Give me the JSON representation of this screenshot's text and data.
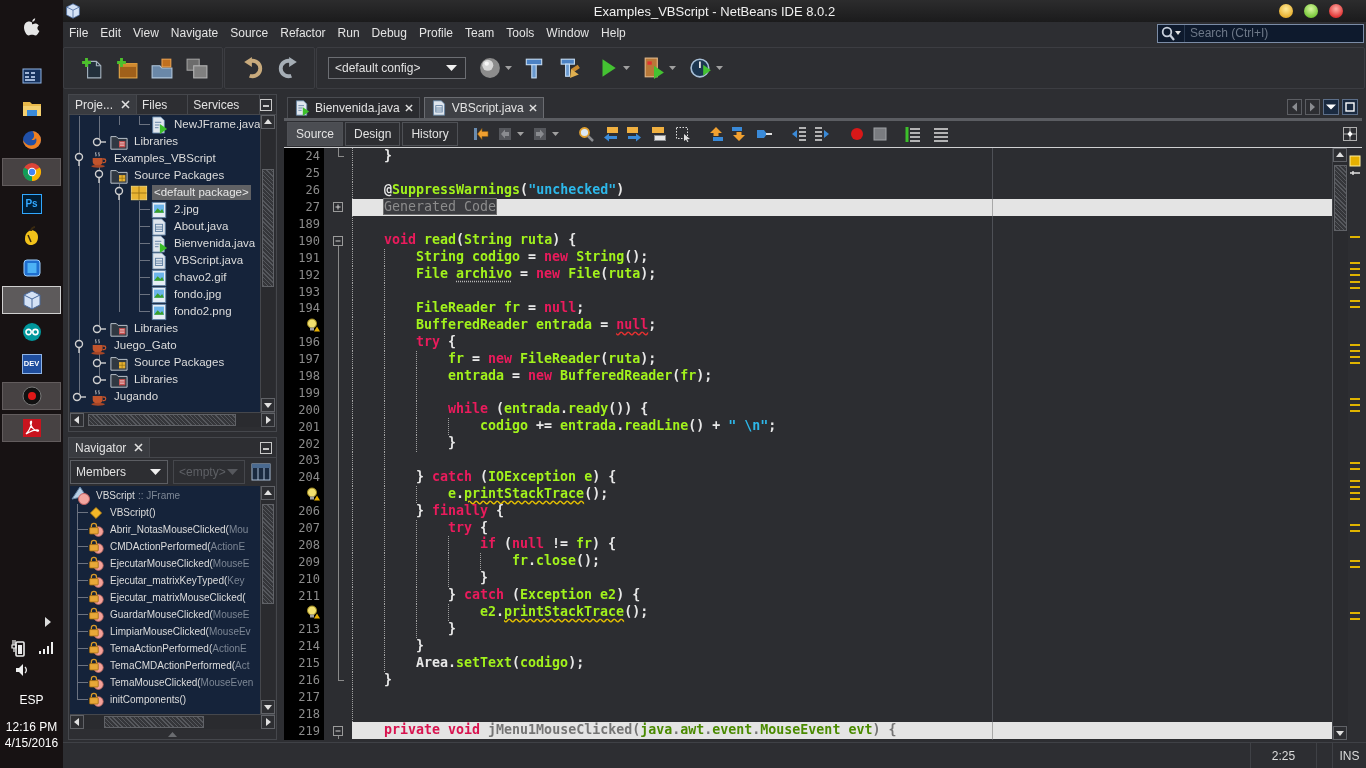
{
  "taskbar": {
    "apps": [
      {
        "kind": "apple",
        "running": false,
        "selected": false
      },
      {
        "kind": "window-grid",
        "running": false,
        "selected": false
      },
      {
        "kind": "explorer",
        "running": false,
        "selected": false
      },
      {
        "kind": "firefox",
        "running": false,
        "selected": false
      },
      {
        "kind": "chrome",
        "running": true,
        "selected": false
      },
      {
        "kind": "photoshop",
        "label": "Ps",
        "running": false,
        "selected": false
      },
      {
        "kind": "fruit",
        "running": false,
        "selected": false
      },
      {
        "kind": "tablet",
        "running": false,
        "selected": false
      },
      {
        "kind": "cube",
        "running": true,
        "selected": true
      },
      {
        "kind": "infinity",
        "running": false,
        "selected": false
      },
      {
        "kind": "devcpp",
        "label": "DEV",
        "running": false,
        "selected": false
      },
      {
        "kind": "record",
        "running": true,
        "selected": false
      },
      {
        "kind": "pdf",
        "running": true,
        "selected": false
      }
    ],
    "language": "ESP",
    "time": "12:16 PM",
    "date": "4/15/2016"
  },
  "window": {
    "title": "Examples_VBScript - NetBeans IDE 8.0.2"
  },
  "menu": [
    "File",
    "Edit",
    "View",
    "Navigate",
    "Source",
    "Refactor",
    "Run",
    "Debug",
    "Profile",
    "Team",
    "Tools",
    "Window",
    "Help"
  ],
  "search": {
    "placeholder": "Search (Ctrl+I)"
  },
  "toolbar": {
    "config": "<default config>"
  },
  "projects": {
    "tabs": [
      {
        "label": "Proje...",
        "selected": true,
        "closable": true
      },
      {
        "label": "Files",
        "selected": false,
        "closable": false
      },
      {
        "label": "Services",
        "selected": false,
        "closable": false
      }
    ],
    "tree": [
      {
        "children": [
          {
            "children": [
              {
                "children": [
                  {
                    "kind": "form",
                    "label": "NewJFrame.java",
                    "selected": false
                  }
                ]
              }
            ]
          },
          {
            "kind": "libraries",
            "label": "Libraries",
            "expanded": false,
            "selected": false
          }
        ]
      },
      {
        "kind": "project",
        "label": "Examples_VBScript",
        "expanded": true,
        "selected": false,
        "children": [
          {
            "kind": "source-packages",
            "label": "Source Packages",
            "expanded": true,
            "selected": false,
            "children": [
              {
                "kind": "package",
                "label": "<default package>",
                "expanded": true,
                "selected": true,
                "children": [
                  {
                    "kind": "image",
                    "label": "2.jpg",
                    "selected": false
                  },
                  {
                    "kind": "java",
                    "label": "About.java",
                    "selected": false
                  },
                  {
                    "kind": "form",
                    "label": "Bienvenida.java",
                    "selected": false
                  },
                  {
                    "kind": "java",
                    "label": "VBScript.java",
                    "selected": false
                  },
                  {
                    "kind": "image",
                    "label": "chavo2.gif",
                    "selected": false
                  },
                  {
                    "kind": "image",
                    "label": "fondo.jpg",
                    "selected": false
                  },
                  {
                    "kind": "image",
                    "label": "fondo2.png",
                    "selected": false
                  }
                ]
              }
            ]
          },
          {
            "kind": "libraries",
            "label": "Libraries",
            "expanded": false,
            "selected": false
          }
        ]
      },
      {
        "kind": "project",
        "label": "Juego_Gato",
        "expanded": true,
        "selected": false,
        "children": [
          {
            "kind": "source-packages",
            "label": "Source Packages",
            "expanded": false,
            "selected": false
          },
          {
            "kind": "libraries",
            "label": "Libraries",
            "expanded": false,
            "selected": false
          }
        ]
      },
      {
        "kind": "project",
        "label": "Jugando",
        "expanded": false,
        "selected": false
      }
    ]
  },
  "navigator": {
    "title": "Navigator",
    "view": "Members",
    "filter": {
      "text": "<empty>",
      "disabled": true
    },
    "members": [
      {
        "kind": "class",
        "label": "VBScript",
        "detail": ":: JFrame",
        "children": [
          {
            "kind": "constructor",
            "label": "VBScript()"
          },
          {
            "kind": "private-method",
            "label": "Abrir_NotasMouseClicked(",
            "detail": "Mou"
          },
          {
            "kind": "private-method",
            "label": "CMDActionPerformed(",
            "detail": "ActionE"
          },
          {
            "kind": "private-method",
            "label": "EjecutarMouseClicked(",
            "detail": "MouseE"
          },
          {
            "kind": "private-method",
            "label": "Ejecutar_matrixKeyTyped(",
            "detail": "Key"
          },
          {
            "kind": "private-method",
            "label": "Ejecutar_matrixMouseClicked("
          },
          {
            "kind": "private-method",
            "label": "GuardarMouseClicked(",
            "detail": "MouseE"
          },
          {
            "kind": "private-method",
            "label": "LimpiarMouseClicked(",
            "detail": "MouseEv"
          },
          {
            "kind": "private-method",
            "label": "TemaActionPerformed(",
            "detail": "ActionE"
          },
          {
            "kind": "private-method",
            "label": "TemaCMDActionPerformed(",
            "detail": "Act"
          },
          {
            "kind": "private-method",
            "label": "TemaMouseClicked(",
            "detail": "MouseEven"
          },
          {
            "kind": "private-method",
            "label": "initComponents()"
          }
        ]
      }
    ]
  },
  "editor": {
    "tabs": [
      {
        "kind": "form",
        "label": "Bienvenida.java",
        "selected": false
      },
      {
        "kind": "java",
        "label": "VBScript.java",
        "selected": true
      }
    ],
    "views": [
      {
        "label": "Source",
        "selected": true
      },
      {
        "label": "Design",
        "selected": false
      },
      {
        "label": "History",
        "selected": false
      }
    ],
    "lines": [
      {
        "kind": "fold-end",
        "number": "24",
        "hint": false,
        "highlight": false,
        "tokens": [
          {
            "kind": "plain",
            "text": "    }"
          }
        ]
      },
      {
        "kind": "plain",
        "number": "25",
        "hint": false,
        "highlight": false
      },
      {
        "kind": "plain",
        "number": "26",
        "hint": false,
        "highlight": false,
        "tokens": [
          {
            "kind": "plain",
            "text": "    @"
          },
          {
            "kind": "name",
            "text": "SuppressWarnings"
          },
          {
            "kind": "plain",
            "text": "("
          },
          {
            "kind": "string",
            "text": "\"unchecked\""
          },
          {
            "kind": "plain",
            "text": ")"
          }
        ]
      },
      {
        "kind": "fold-collapsed",
        "number": "27",
        "hint": false,
        "highlight": true,
        "tokens": [
          {
            "kind": "folded",
            "text": "    Generated Code"
          }
        ]
      },
      {
        "kind": "plain",
        "number": "189",
        "hint": false,
        "highlight": false
      },
      {
        "kind": "fold-expanded",
        "number": "190",
        "hint": false,
        "highlight": false,
        "tokens": [
          {
            "kind": "keyword",
            "text": "    void"
          },
          {
            "kind": "name",
            "text": " read"
          },
          {
            "kind": "plain",
            "text": "("
          },
          {
            "kind": "name",
            "text": "String ruta"
          },
          {
            "kind": "plain",
            "text": ") {"
          }
        ]
      },
      {
        "kind": "fold-body",
        "number": "191",
        "hint": false,
        "highlight": false,
        "tokens": [
          {
            "kind": "name",
            "text": "        String codigo"
          },
          {
            "kind": "plain",
            "text": " = "
          },
          {
            "kind": "keyword",
            "text": "new"
          },
          {
            "kind": "name",
            "text": " String"
          },
          {
            "kind": "plain",
            "text": "();"
          }
        ]
      },
      {
        "kind": "fold-body",
        "number": "192",
        "hint": false,
        "highlight": false,
        "tokens": [
          {
            "kind": "name",
            "text": "        File "
          },
          {
            "kind": "unused",
            "text": "archivo"
          },
          {
            "kind": "plain",
            "text": " = "
          },
          {
            "kind": "keyword",
            "text": "new"
          },
          {
            "kind": "name",
            "text": " File"
          },
          {
            "kind": "plain",
            "text": "("
          },
          {
            "kind": "name",
            "text": "ruta"
          },
          {
            "kind": "plain",
            "text": ");"
          }
        ]
      },
      {
        "kind": "fold-body",
        "number": "193",
        "hint": false,
        "highlight": false
      },
      {
        "kind": "fold-body",
        "number": "194",
        "hint": false,
        "highlight": false,
        "tokens": [
          {
            "kind": "name",
            "text": "        FileReader fr"
          },
          {
            "kind": "plain",
            "text": " = "
          },
          {
            "kind": "keyword",
            "text": "null"
          },
          {
            "kind": "plain",
            "text": ";"
          }
        ]
      },
      {
        "kind": "fold-body",
        "hint": true,
        "highlight": false,
        "tokens": [
          {
            "kind": "name",
            "text": "        BufferedReader entrada"
          },
          {
            "kind": "plain",
            "text": " = "
          },
          {
            "kind": "error",
            "text": "null"
          },
          {
            "kind": "plain",
            "text": ";"
          }
        ]
      },
      {
        "kind": "fold-body",
        "number": "196",
        "hint": false,
        "highlight": false,
        "tokens": [
          {
            "kind": "keyword",
            "text": "        try"
          },
          {
            "kind": "plain",
            "text": " {"
          }
        ]
      },
      {
        "kind": "fold-body",
        "number": "197",
        "hint": false,
        "highlight": false,
        "tokens": [
          {
            "kind": "name",
            "text": "            fr"
          },
          {
            "kind": "plain",
            "text": " = "
          },
          {
            "kind": "keyword",
            "text": "new"
          },
          {
            "kind": "name",
            "text": " FileReader"
          },
          {
            "kind": "plain",
            "text": "("
          },
          {
            "kind": "name",
            "text": "ruta"
          },
          {
            "kind": "plain",
            "text": ");"
          }
        ]
      },
      {
        "kind": "fold-body",
        "number": "198",
        "hint": false,
        "highlight": false,
        "tokens": [
          {
            "kind": "name",
            "text": "            entrada"
          },
          {
            "kind": "plain",
            "text": " = "
          },
          {
            "kind": "keyword",
            "text": "new"
          },
          {
            "kind": "name",
            "text": " BufferedReader"
          },
          {
            "kind": "plain",
            "text": "("
          },
          {
            "kind": "name",
            "text": "fr"
          },
          {
            "kind": "plain",
            "text": ");"
          }
        ]
      },
      {
        "kind": "fold-body",
        "number": "199",
        "hint": false,
        "highlight": false
      },
      {
        "kind": "fold-body",
        "number": "200",
        "hint": false,
        "highlight": false,
        "tokens": [
          {
            "kind": "keyword",
            "text": "            while"
          },
          {
            "kind": "plain",
            "text": " ("
          },
          {
            "kind": "name",
            "text": "entrada"
          },
          {
            "kind": "plain",
            "text": "."
          },
          {
            "kind": "name",
            "text": "ready"
          },
          {
            "kind": "plain",
            "text": "()) {"
          }
        ]
      },
      {
        "kind": "fold-body",
        "number": "201",
        "hint": false,
        "highlight": false,
        "tokens": [
          {
            "kind": "name",
            "text": "                codigo"
          },
          {
            "kind": "plain",
            "text": " += "
          },
          {
            "kind": "name",
            "text": "entrada"
          },
          {
            "kind": "plain",
            "text": "."
          },
          {
            "kind": "name",
            "text": "readLine"
          },
          {
            "kind": "plain",
            "text": "() + "
          },
          {
            "kind": "string",
            "text": "\" \\n\""
          },
          {
            "kind": "plain",
            "text": ";"
          }
        ]
      },
      {
        "kind": "fold-body",
        "number": "202",
        "hint": false,
        "highlight": false,
        "tokens": [
          {
            "kind": "plain",
            "text": "            }"
          }
        ]
      },
      {
        "kind": "fold-body",
        "number": "203",
        "hint": false,
        "highlight": false
      },
      {
        "kind": "fold-body",
        "number": "204",
        "hint": false,
        "highlight": false,
        "tokens": [
          {
            "kind": "plain",
            "text": "        } "
          },
          {
            "kind": "keyword",
            "text": "catch"
          },
          {
            "kind": "plain",
            "text": " ("
          },
          {
            "kind": "name",
            "text": "IOException e"
          },
          {
            "kind": "plain",
            "text": ") {"
          }
        ]
      },
      {
        "kind": "fold-body",
        "hint": true,
        "highlight": false,
        "tokens": [
          {
            "kind": "name",
            "text": "            e"
          },
          {
            "kind": "plain",
            "text": "."
          },
          {
            "kind": "warning",
            "text": "printStackTrace"
          },
          {
            "kind": "plain",
            "text": "();"
          }
        ]
      },
      {
        "kind": "fold-body",
        "number": "206",
        "hint": false,
        "highlight": false,
        "tokens": [
          {
            "kind": "plain",
            "text": "        } "
          },
          {
            "kind": "keyword",
            "text": "finally"
          },
          {
            "kind": "plain",
            "text": " {"
          }
        ]
      },
      {
        "kind": "fold-body",
        "number": "207",
        "hint": false,
        "highlight": false,
        "tokens": [
          {
            "kind": "keyword",
            "text": "            try"
          },
          {
            "kind": "plain",
            "text": " {"
          }
        ]
      },
      {
        "kind": "fold-body",
        "number": "208",
        "hint": false,
        "highlight": false,
        "tokens": [
          {
            "kind": "keyword",
            "text": "                if"
          },
          {
            "kind": "plain",
            "text": " ("
          },
          {
            "kind": "keyword",
            "text": "null"
          },
          {
            "kind": "plain",
            "text": " != "
          },
          {
            "kind": "name",
            "text": "fr"
          },
          {
            "kind": "plain",
            "text": ") {"
          }
        ]
      },
      {
        "kind": "fold-body",
        "number": "209",
        "hint": false,
        "highlight": false,
        "tokens": [
          {
            "kind": "name",
            "text": "                    fr"
          },
          {
            "kind": "plain",
            "text": "."
          },
          {
            "kind": "name",
            "text": "close"
          },
          {
            "kind": "plain",
            "text": "();"
          }
        ]
      },
      {
        "kind": "fold-body",
        "number": "210",
        "hint": false,
        "highlight": false,
        "tokens": [
          {
            "kind": "plain",
            "text": "                }"
          }
        ]
      },
      {
        "kind": "fold-body",
        "number": "211",
        "hint": false,
        "highlight": false,
        "tokens": [
          {
            "kind": "plain",
            "text": "            } "
          },
          {
            "kind": "keyword",
            "text": "catch"
          },
          {
            "kind": "plain",
            "text": " ("
          },
          {
            "kind": "name",
            "text": "Exception e2"
          },
          {
            "kind": "plain",
            "text": ") {"
          }
        ]
      },
      {
        "kind": "fold-body",
        "hint": true,
        "highlight": false,
        "tokens": [
          {
            "kind": "name",
            "text": "                e2"
          },
          {
            "kind": "plain",
            "text": "."
          },
          {
            "kind": "warning",
            "text": "printStackTrace"
          },
          {
            "kind": "plain",
            "text": "();"
          }
        ]
      },
      {
        "kind": "fold-body",
        "number": "213",
        "hint": false,
        "highlight": false,
        "tokens": [
          {
            "kind": "plain",
            "text": "            }"
          }
        ]
      },
      {
        "kind": "fold-body",
        "number": "214",
        "hint": false,
        "highlight": false,
        "tokens": [
          {
            "kind": "plain",
            "text": "        }"
          }
        ]
      },
      {
        "kind": "fold-body",
        "number": "215",
        "hint": false,
        "highlight": false,
        "tokens": [
          {
            "kind": "plain",
            "text": "        Area."
          },
          {
            "kind": "name",
            "text": "setText"
          },
          {
            "kind": "plain",
            "text": "("
          },
          {
            "kind": "name",
            "text": "codigo"
          },
          {
            "kind": "plain",
            "text": ");"
          }
        ]
      },
      {
        "kind": "fold-end",
        "number": "216",
        "hint": false,
        "highlight": false,
        "tokens": [
          {
            "kind": "plain",
            "text": "    }"
          }
        ]
      },
      {
        "kind": "plain",
        "number": "217",
        "hint": false,
        "highlight": false
      },
      {
        "kind": "plain",
        "number": "218",
        "hint": false,
        "highlight": false
      },
      {
        "kind": "fold-expanded",
        "number": "219",
        "hint": false,
        "highlight": true,
        "tokens": [
          {
            "kind": "keyword",
            "text": "    private void"
          },
          {
            "kind": "plain",
            "text": " jMenu1MouseClicked("
          },
          {
            "kind": "name",
            "text": "java"
          },
          {
            "kind": "plain",
            "text": "."
          },
          {
            "kind": "name",
            "text": "awt"
          },
          {
            "kind": "plain",
            "text": "."
          },
          {
            "kind": "name",
            "text": "event"
          },
          {
            "kind": "plain",
            "text": "."
          },
          {
            "kind": "name",
            "text": "MouseEvent evt"
          },
          {
            "kind": "plain",
            "text": ") {"
          }
        ]
      }
    ]
  },
  "status_bar": {
    "position": "2:25",
    "mode": "INS"
  }
}
